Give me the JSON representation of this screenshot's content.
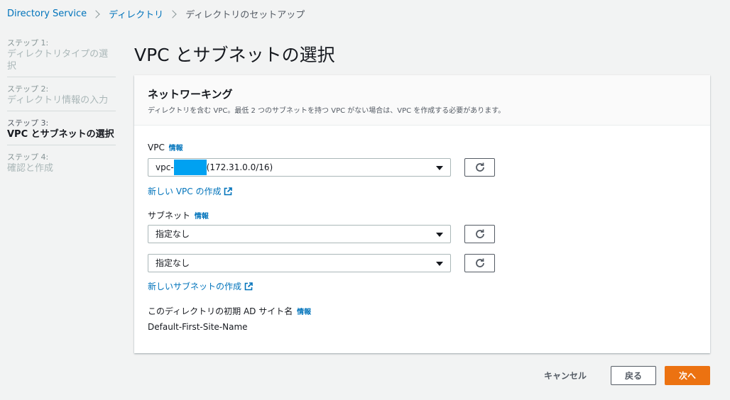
{
  "breadcrumb": {
    "items": [
      "Directory Service",
      "ディレクトリ",
      "ディレクトリのセットアップ"
    ]
  },
  "steps": [
    {
      "num": "ステップ 1:",
      "title": "ディレクトリタイプの選択"
    },
    {
      "num": "ステップ 2:",
      "title": "ディレクトリ情報の入力"
    },
    {
      "num": "ステップ 3:",
      "title": "VPC とサブネットの選択"
    },
    {
      "num": "ステップ 4:",
      "title": "確認と作成"
    }
  ],
  "page": {
    "title": "VPC とサブネットの選択"
  },
  "panel": {
    "header": "ネットワーキング",
    "description": "ディレクトリを含む VPC。最低 2 つのサブネットを持つ VPC がない場合は、VPC を作成する必要があります。",
    "info_label": "情報",
    "vpc": {
      "label": "VPC",
      "value_prefix": "vpc-",
      "value_suffix": "(172.31.0.0/16)",
      "create_link": "新しい VPC の作成"
    },
    "subnet": {
      "label": "サブネット",
      "values": [
        "指定なし",
        "指定なし"
      ],
      "create_link": "新しいサブネットの作成"
    },
    "site": {
      "label": "このディレクトリの初期 AD サイト名",
      "value": "Default-First-Site-Name"
    }
  },
  "footer": {
    "cancel": "キャンセル",
    "back": "戻る",
    "next": "次へ"
  },
  "colors": {
    "accent": "#ec7211",
    "link": "#0073bb",
    "redaction": "#00a1f1"
  },
  "icons": [
    "chevron-right-icon",
    "caret-down-icon",
    "refresh-icon",
    "external-link-icon"
  ]
}
